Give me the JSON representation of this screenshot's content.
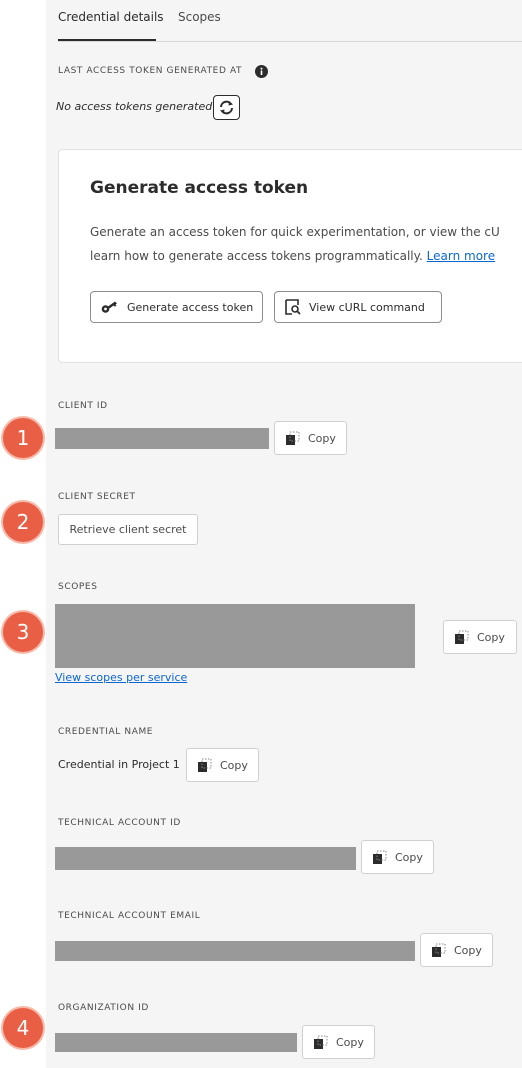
{
  "tabs": [
    {
      "label": "Credential details"
    },
    {
      "label": "Scopes"
    }
  ],
  "access_token": {
    "label": "LAST ACCESS TOKEN GENERATED AT",
    "status": "No access tokens generated"
  },
  "card": {
    "title": "Generate access token",
    "text_line1": "Generate an access token for quick experimentation, or view the cU",
    "text_line2": "learn how to generate access tokens programmatically.",
    "learn_more": "Learn more",
    "generate_button": "Generate access token",
    "curl_button": "View cURL command"
  },
  "client_id": {
    "label": "CLIENT ID",
    "copy": "Copy"
  },
  "client_secret": {
    "label": "CLIENT SECRET",
    "retrieve_button": "Retrieve client secret"
  },
  "scopes": {
    "label": "SCOPES",
    "copy": "Copy",
    "link": "View scopes per service"
  },
  "credential_name": {
    "label": "CREDENTIAL NAME",
    "value": "Credential in Project 1",
    "copy": "Copy"
  },
  "technical_account_id": {
    "label": "TECHNICAL ACCOUNT ID",
    "copy": "Copy"
  },
  "technical_account_email": {
    "label": "TECHNICAL ACCOUNT EMAIL",
    "copy": "Copy"
  },
  "organization_id": {
    "label": "ORGANIZATION ID",
    "copy": "Copy"
  },
  "badges": [
    "1",
    "2",
    "3",
    "4"
  ],
  "colors": {
    "badge": "#e95f45",
    "link": "#0d66d0",
    "redaction": "#999999"
  }
}
